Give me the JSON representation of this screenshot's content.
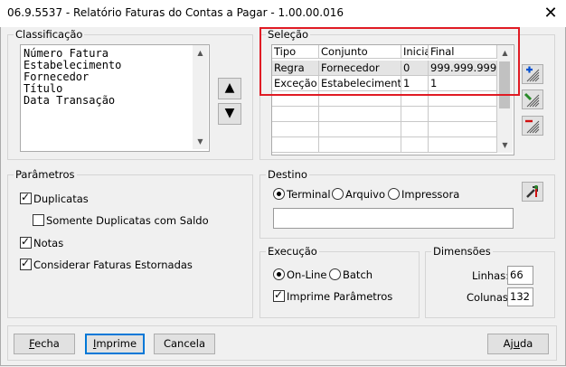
{
  "window": {
    "title": "06.9.5537 - Relatório Faturas do Contas a Pagar - 1.00.00.016",
    "close_symbol": "✕"
  },
  "classificacao": {
    "legend": "Classificação",
    "items": [
      "Número  Fatura",
      "Estabelecimento",
      "Fornecedor",
      "Título",
      "Data Transação"
    ],
    "move_up_symbol": "▲",
    "move_down_symbol": "▼"
  },
  "selecao": {
    "legend": "Seleção",
    "columns": [
      "Tipo",
      "Conjunto",
      "Inicial",
      "Final"
    ],
    "rows": [
      [
        "Regra",
        "Fornecedor",
        "0",
        "999.999.999"
      ],
      [
        "Exceção",
        "Estabelecimento",
        "1",
        "1"
      ]
    ],
    "buttons": {
      "add_icon": "plus-icon",
      "edit_icon": "pencil-icon",
      "remove_icon": "minus-icon"
    }
  },
  "parametros": {
    "legend": "Parâmetros",
    "duplicatas": {
      "label": "Duplicatas",
      "checked": true
    },
    "somente_duplicatas": {
      "label": "Somente Duplicatas com Saldo",
      "checked": false
    },
    "notas": {
      "label": "Notas",
      "checked": true
    },
    "estornadas": {
      "label": "Considerar Faturas Estornadas",
      "checked": true
    }
  },
  "destino": {
    "legend": "Destino",
    "options": [
      "Terminal",
      "Arquivo",
      "Impressora"
    ],
    "selected": "Terminal",
    "file_value": "",
    "config_icon": "tools-icon"
  },
  "execucao": {
    "legend": "Execução",
    "options": [
      "On-Line",
      "Batch"
    ],
    "selected": "On-Line",
    "imprime_parametros": {
      "label": "Imprime Parâmetros",
      "checked": true
    }
  },
  "dimensoes": {
    "legend": "Dimensões",
    "linhas_label": "Linhas:",
    "linhas_value": "66",
    "colunas_label": "Colunas:",
    "colunas_value": "132"
  },
  "footer": {
    "fecha_pre": "F",
    "fecha_rest": "echa",
    "imprime_pre": "I",
    "imprime_rest": "mprime",
    "cancela": "Cancela",
    "ajuda_pre": "Aj",
    "ajuda_u": "u",
    "ajuda_rest": "da"
  },
  "colors": {
    "highlight": "#e01b24",
    "add": "#0050d0",
    "remove": "#d01010"
  }
}
